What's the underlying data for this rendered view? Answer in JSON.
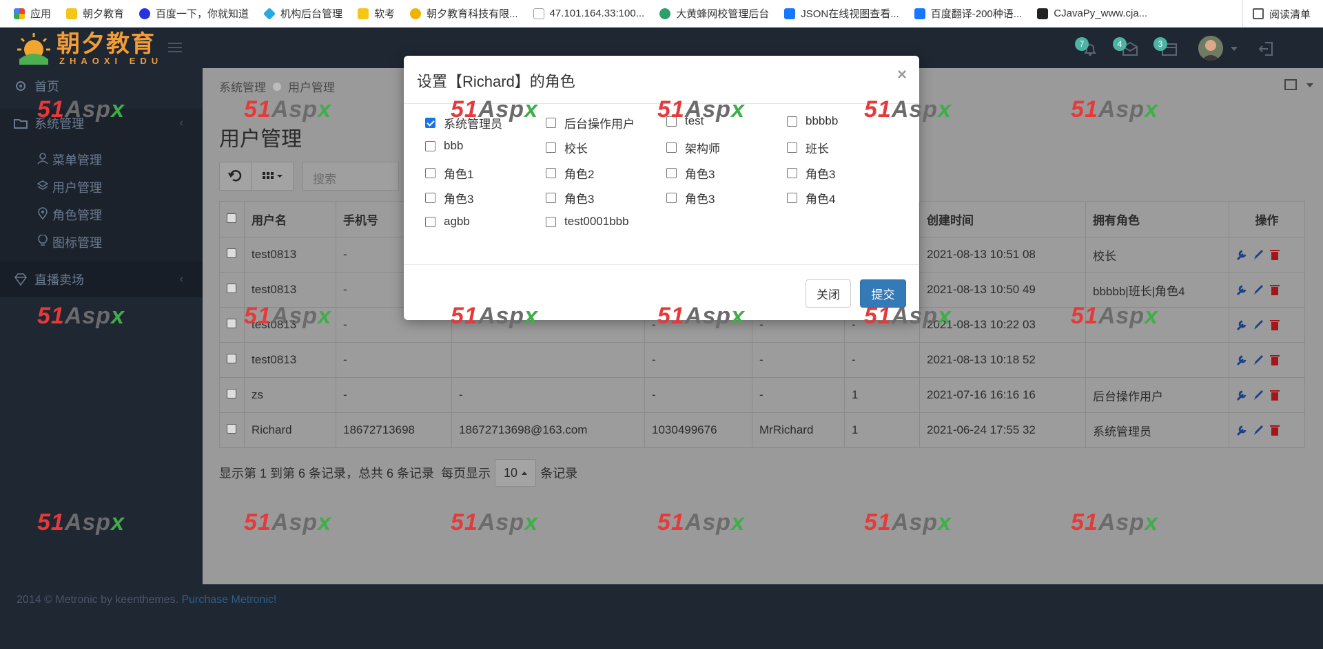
{
  "bookmarks": [
    {
      "label": "应用",
      "color": "#e94235"
    },
    {
      "label": "朝夕教育",
      "color": "#f5c518"
    },
    {
      "label": "百度一下，你就知道",
      "color": "#2932e1"
    },
    {
      "label": "机构后台管理",
      "color": "#2aa9e0"
    },
    {
      "label": "软考",
      "color": "#f5c518"
    },
    {
      "label": "朝夕教育科技有限...",
      "color": "#f0b400"
    },
    {
      "label": "47.101.164.33:100...",
      "color": "#9aa0a6"
    },
    {
      "label": "大黄蜂网校管理后台",
      "color": "#2c9f6b"
    },
    {
      "label": "JSON在线视图查看...",
      "color": "#1677ff"
    },
    {
      "label": "百度翻译-200种语...",
      "color": "#1677ff"
    },
    {
      "label": "CJavaPy_www.cja...",
      "color": "#222222"
    }
  ],
  "reader_mode": "阅读清单",
  "logo": {
    "cn": "朝夕教育",
    "en": "ZHAOXI EDU"
  },
  "header": {
    "badges": [
      "7",
      "4",
      "3"
    ]
  },
  "sidebar": {
    "home": "首页",
    "system": "系统管理",
    "sub_items": [
      "菜单管理",
      "用户管理",
      "角色管理",
      "图标管理"
    ],
    "live": "直播卖场"
  },
  "breadcrumb": [
    "系统管理",
    "用户管理"
  ],
  "page_title": "用户管理",
  "search": {
    "placeholder": "搜索"
  },
  "table": {
    "headers": [
      "用户名",
      "手机号",
      "",
      "",
      "",
      "",
      "创建时间",
      "拥有角色",
      "操作"
    ],
    "rows": [
      {
        "c": [
          "test0813",
          "-",
          "",
          "",
          "",
          "",
          "2021-08-13 10:51 08",
          "校长"
        ]
      },
      {
        "c": [
          "test0813",
          "-",
          "",
          "",
          "",
          "",
          "2021-08-13 10:50 49",
          "bbbbb|班长|角色4"
        ]
      },
      {
        "c": [
          "test0813",
          "-",
          "",
          "-",
          "-",
          "-",
          "2021-08-13 10:22 03",
          ""
        ]
      },
      {
        "c": [
          "test0813",
          "-",
          "",
          "-",
          "-",
          "-",
          "2021-08-13 10:18 52",
          ""
        ]
      },
      {
        "c": [
          "zs",
          "-",
          "-",
          "-",
          "-",
          "1",
          "2021-07-16 16:16 16",
          "后台操作用户"
        ]
      },
      {
        "c": [
          "Richard",
          "18672713698",
          "18672713698@163.com",
          "1030499676",
          "MrRichard",
          "1",
          "2021-06-24 17:55 32",
          "系统管理员"
        ]
      }
    ]
  },
  "pager": {
    "prefix": "显示第 1 到第 6 条记录，总共 6 条记录",
    "per_page_label": "每页显示",
    "per_page": "10",
    "suffix": "条记录"
  },
  "footer": {
    "text": "2014 © Metronic by keenthemes.",
    "link": "Purchase Metronic!"
  },
  "modal": {
    "title": "设置【Richard】的角色",
    "close_symbol": "×",
    "roles": [
      {
        "label": "系统管理员",
        "checked": true
      },
      {
        "label": "后台操作用户",
        "checked": false
      },
      {
        "label": "test",
        "checked": false
      },
      {
        "label": "bbbbb",
        "checked": false
      },
      {
        "label": "bbb",
        "checked": false
      },
      {
        "label": "校长",
        "checked": false
      },
      {
        "label": "架构师",
        "checked": false
      },
      {
        "label": "班长",
        "checked": false
      },
      {
        "label": "角色1",
        "checked": false
      },
      {
        "label": "角色2",
        "checked": false
      },
      {
        "label": "角色3",
        "checked": false
      },
      {
        "label": "角色3",
        "checked": false
      },
      {
        "label": "角色3",
        "checked": false
      },
      {
        "label": "角色3",
        "checked": false
      },
      {
        "label": "角色3",
        "checked": false
      },
      {
        "label": "角色4",
        "checked": false
      },
      {
        "label": "agbb",
        "checked": false
      },
      {
        "label": "test0001bbb",
        "checked": false
      }
    ],
    "close_button": "关闭",
    "submit_button": "提交"
  },
  "watermark": {
    "a": "51",
    "b": "Asp",
    "c": "x"
  }
}
